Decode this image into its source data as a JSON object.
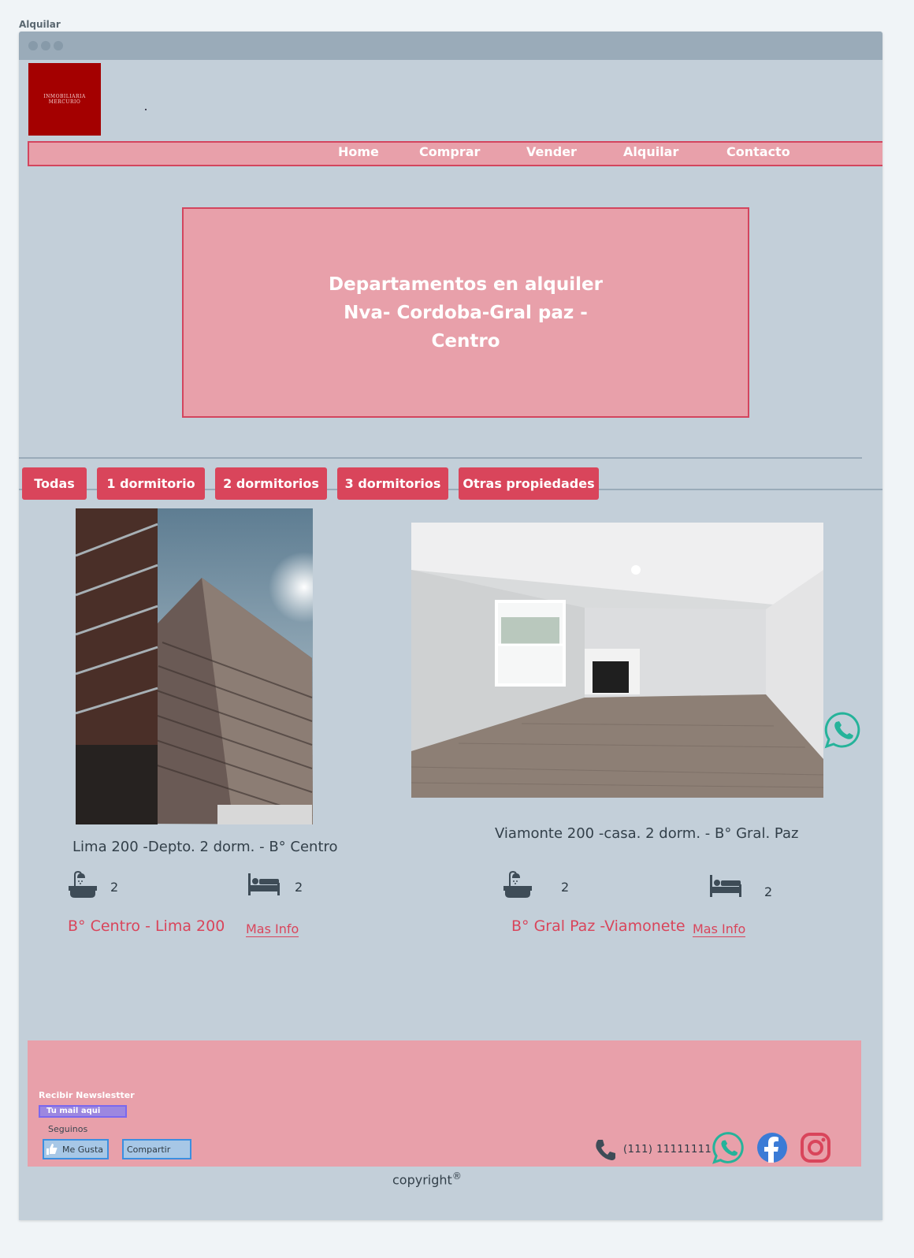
{
  "page_label": "Alquilar",
  "logo": {
    "line1": "INMOBILIARIA",
    "line2": "MERCURIO",
    "color": "#a40000"
  },
  "nav": {
    "items": [
      "Home",
      "Comprar",
      "Vender",
      "Alquilar",
      "Contacto"
    ]
  },
  "hero": {
    "line1": "Departamentos en alquiler",
    "line2": "Nva- Cordoba-Gral paz -",
    "line3": "Centro"
  },
  "filters": [
    "Todas",
    "1 dormitorio",
    "2 dormitorios",
    "3 dormitorios",
    "Otras propiedades"
  ],
  "listings": [
    {
      "caption": "Lima 200 -Depto. 2 dorm. - B° Centro",
      "baths": "2",
      "beds": "2",
      "location": "B° Centro - Lima 200",
      "more": "Mas Info",
      "image_icon": "building-photo"
    },
    {
      "caption": "Viamonte 200 -casa. 2 dorm. - B° Gral. Paz",
      "baths": "2",
      "beds": "2",
      "location": "B° Gral Paz -Viamonete",
      "more": "Mas Info",
      "image_icon": "living-room-photo"
    }
  ],
  "footer": {
    "newsletter_label": "Recibir Newslestter",
    "mail_placeholder": "Tu mail aqui",
    "follow_label": "Seguinos",
    "like_label": "Me Gusta",
    "share_label": "Compartir",
    "phone": "(111) 11111111",
    "copyright": "copyright",
    "copyright_mark": "®"
  },
  "colors": {
    "accent": "#d9455b",
    "pink_panel": "#e8a0aa",
    "background": "#c3cfd9",
    "whatsapp": "#25b39a",
    "facebook": "#3b7bd6",
    "instagram": "#d9455b"
  }
}
